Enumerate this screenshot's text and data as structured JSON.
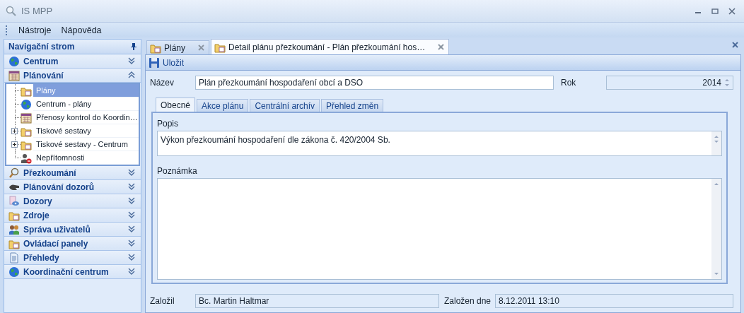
{
  "window": {
    "title": "IS MPP"
  },
  "menu": [
    {
      "label": "Nástroje"
    },
    {
      "label": "Nápověda"
    }
  ],
  "navigation": {
    "title": "Navigační strom",
    "groups": [
      {
        "label": "Centrum",
        "expanded": false
      },
      {
        "label": "Plánování",
        "expanded": true,
        "items": [
          {
            "label": "Plány",
            "selected": true,
            "kind": "leaf"
          },
          {
            "label": "Centrum - plány",
            "selected": false,
            "kind": "leaf"
          },
          {
            "label": "Přenosy kontrol do Koordin…",
            "selected": false,
            "kind": "leaf"
          },
          {
            "label": "Tiskové sestavy",
            "selected": false,
            "kind": "node"
          },
          {
            "label": "Tiskové sestavy - Centrum",
            "selected": false,
            "kind": "node"
          },
          {
            "label": "Nepřítomnosti",
            "selected": false,
            "kind": "leaf"
          }
        ]
      },
      {
        "label": "Přezkoumání",
        "expanded": false
      },
      {
        "label": "Plánování dozorů",
        "expanded": false
      },
      {
        "label": "Dozory",
        "expanded": false
      },
      {
        "label": "Zdroje",
        "expanded": false
      },
      {
        "label": "Správa uživatelů",
        "expanded": false
      },
      {
        "label": "Ovládací panely",
        "expanded": false
      },
      {
        "label": "Přehledy",
        "expanded": false
      },
      {
        "label": "Koordinační centrum",
        "expanded": false
      }
    ]
  },
  "document_tabs": [
    {
      "label": "Plány",
      "selected": false
    },
    {
      "label": "Detail plánu přezkoumání - Plán přezkoumání hos…",
      "selected": true
    }
  ],
  "toolbar": {
    "save": "Uložit"
  },
  "form": {
    "name": {
      "label": "Název",
      "value": "Plán přezkoumání hospodaření obcí a DSO"
    },
    "year": {
      "label": "Rok",
      "value": "2014"
    },
    "tabs": [
      {
        "label": "Obecné",
        "selected": true
      },
      {
        "label": "Akce plánu",
        "selected": false
      },
      {
        "label": "Centrální archív",
        "selected": false
      },
      {
        "label": "Přehled změn",
        "selected": false
      }
    ],
    "description": {
      "label": "Popis",
      "value": "Výkon přezkoumání hospodaření dle zákona č. 420/2004 Sb."
    },
    "note": {
      "label": "Poznámka"
    },
    "created_by": {
      "label": "Založil",
      "value": "Bc. Martin Haltmar"
    },
    "created_on": {
      "label": "Založen dne",
      "value": "8.12.2011 13:10"
    }
  }
}
